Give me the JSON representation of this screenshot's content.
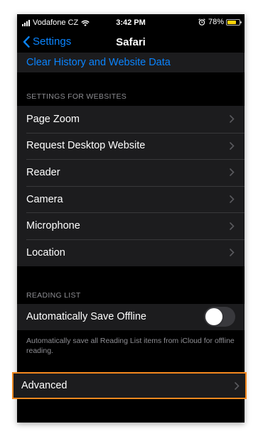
{
  "status_bar": {
    "carrier": "Vodafone CZ",
    "time": "3:42 PM",
    "battery_pct": "78%",
    "battery_level": 0.78,
    "icons": [
      "signal-icon",
      "wifi-icon",
      "alarm-icon",
      "battery-icon"
    ]
  },
  "nav": {
    "back_label": "Settings",
    "title": "Safari"
  },
  "top_link": "Clear History and Website Data",
  "settings_for_websites": {
    "header": "SETTINGS FOR WEBSITES",
    "items": [
      {
        "label": "Page Zoom"
      },
      {
        "label": "Request Desktop Website"
      },
      {
        "label": "Reader"
      },
      {
        "label": "Camera"
      },
      {
        "label": "Microphone"
      },
      {
        "label": "Location"
      }
    ]
  },
  "reading_list": {
    "header": "READING LIST",
    "auto_save_label": "Automatically Save Offline",
    "auto_save_on": false,
    "footer": "Automatically save all Reading List items from iCloud for offline reading."
  },
  "advanced": {
    "label": "Advanced",
    "highlight_color": "#f4881f"
  },
  "colors": {
    "accent": "#0a84ff",
    "cell_bg": "#1c1c1e",
    "background": "#000000"
  }
}
